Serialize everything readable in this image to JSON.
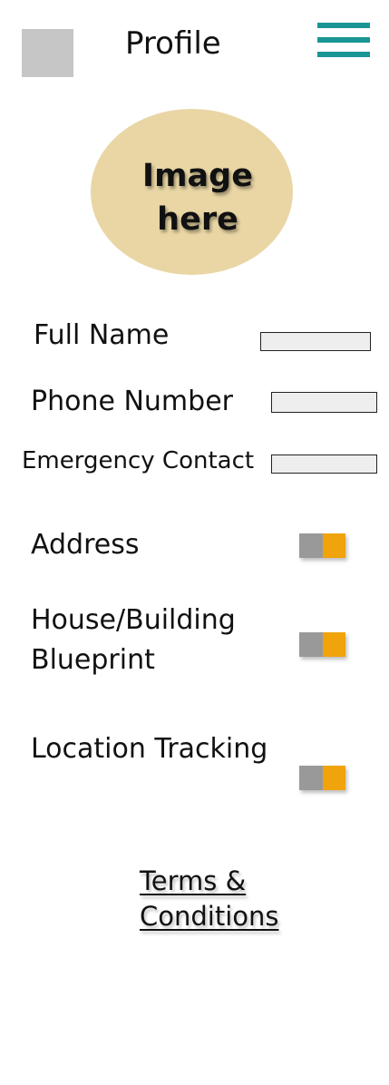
{
  "header": {
    "title": "Profile",
    "menu_icon": "hamburger-menu-icon",
    "menu_color": "#1a9595"
  },
  "avatar": {
    "placeholder_text": "Image\nhere",
    "color": "#e9d6a4"
  },
  "form": {
    "full_name_label": "Full Name",
    "full_name_value": "",
    "phone_label": "Phone Number",
    "phone_value": "",
    "emergency_label": "Emergency Contact",
    "emergency_value": ""
  },
  "toggles": {
    "address_label": "Address",
    "blueprint_label": "House/Building\nBlueprint",
    "location_label": "Location Tracking",
    "on_color": "#f0a30a",
    "knob_color": "#999999"
  },
  "footer": {
    "terms_label": "Terms &\nConditions"
  }
}
